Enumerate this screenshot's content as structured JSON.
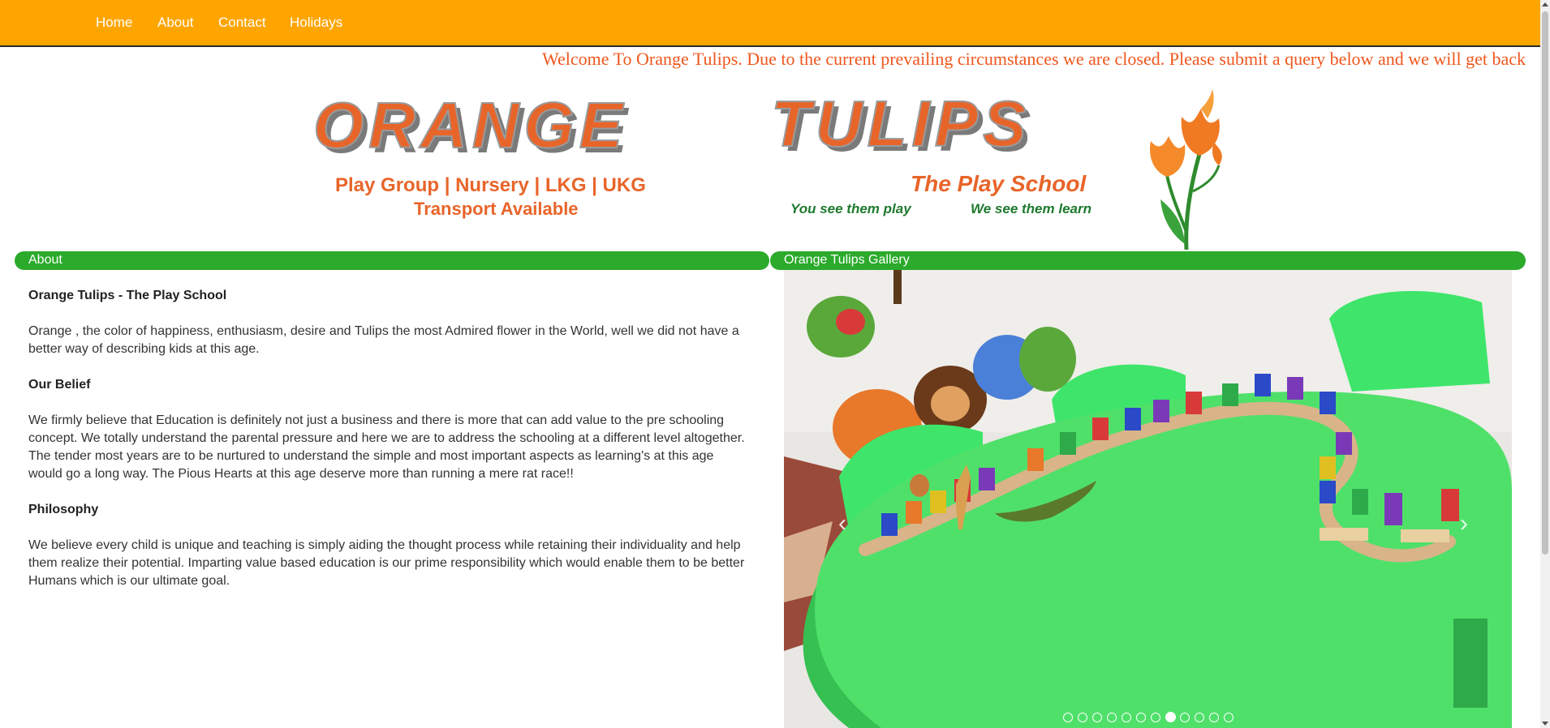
{
  "nav": {
    "items": [
      {
        "label": "Home"
      },
      {
        "label": "About"
      },
      {
        "label": "Contact"
      },
      {
        "label": "Holidays"
      }
    ]
  },
  "marquee": {
    "text": "Welcome To Orange Tulips. Due to the current prevailing circumstances we are closed. Please submit a query below and we will get back"
  },
  "logo": {
    "title_left": "ORANGE",
    "title_right": "TULIPS",
    "classes_line": "Play Group | Nursery | LKG | UKG",
    "transport_line": "Transport Available",
    "subtitle": "The Play School",
    "tagline_1": "You see them play",
    "tagline_2": "We see them learn"
  },
  "about": {
    "header": "About",
    "heading_1": "Orange Tulips - The Play School",
    "para_1": "Orange , the color of happiness, enthusiasm, desire and Tulips the most Admired flower in the World, well we did not have a better way of describing kids at this age.",
    "heading_2": "Our Belief",
    "para_2": "We firmly believe that Education is definitely not just a business and there is more that can add value to the pre schooling concept. We totally understand the parental pressure and here we are to address the schooling at a different level altogether. The tender most years are to be nurtured to understand the simple and most important aspects as learning's at this age would go a long way. The Pious Hearts at this age deserve more than running a mere rat race!!",
    "heading_3": "Philosophy",
    "para_3": "We believe every child is unique and teaching is simply aiding the thought process while retaining their individuality and help them realize their potential. Imparting value based education is our prime responsibility which would enable them to be better Humans which is our ultimate goal."
  },
  "gallery": {
    "header": "Orange Tulips Gallery",
    "prev_icon": "chevron-left-icon",
    "next_icon": "chevron-right-icon",
    "slide_count": 12,
    "active_slide": 7
  },
  "colors": {
    "nav_bg": "#FFA500",
    "accent_orange": "#F0571D",
    "header_green": "#2BAA2B",
    "logo_green": "#1E7A2E"
  }
}
